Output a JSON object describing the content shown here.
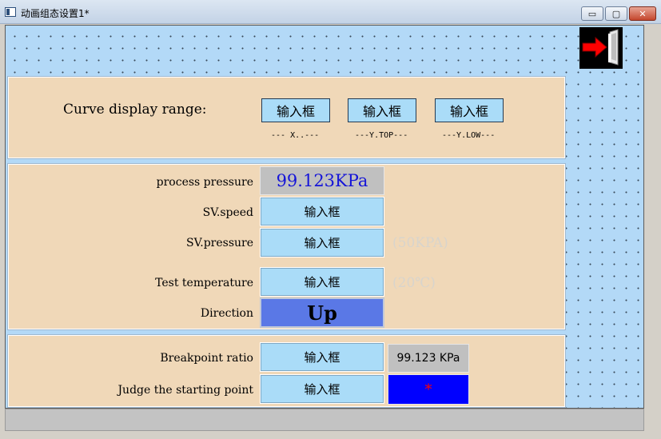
{
  "window": {
    "title": "动画组态设置1*",
    "min_label": "▭",
    "max_label": "▢",
    "close_label": "✕"
  },
  "range": {
    "label": "Curve display range:",
    "inputs": [
      {
        "value": "输入框",
        "caption": "--- X..---"
      },
      {
        "value": "输入框",
        "caption": "---Y.TOP---"
      },
      {
        "value": "输入框",
        "caption": "---Y.LOW---"
      }
    ]
  },
  "process": {
    "pressure_label": "process pressure",
    "pressure_value": "99.123KPa",
    "speed_label": "SV.speed",
    "speed_value": "输入框",
    "sv_pressure_label": "SV.pressure",
    "sv_pressure_value": "输入框",
    "sv_pressure_hint": "(50KPA)",
    "temp_label": "Test temperature",
    "temp_value": "输入框",
    "temp_hint": "(20℃)",
    "direction_label": "Direction",
    "direction_value": "Up"
  },
  "breakpoint": {
    "ratio_label": "Breakpoint ratio",
    "ratio_value": "输入框",
    "ratio_display": "99.123 KPa",
    "judge_label": "Judge the starting point",
    "judge_value": "输入框",
    "judge_indicator": "*"
  },
  "colors": {
    "client_bg": "#b3d9f7",
    "panel_bg": "#f0d8b8",
    "input_bg": "#aadcf8",
    "direction_bg": "#5a78e6",
    "indicator_bg": "#0000ff",
    "indicator_mark": "#ff0000",
    "pressure_text": "#1414d8"
  },
  "icons": {
    "exit": "exit-door-arrow-icon"
  }
}
